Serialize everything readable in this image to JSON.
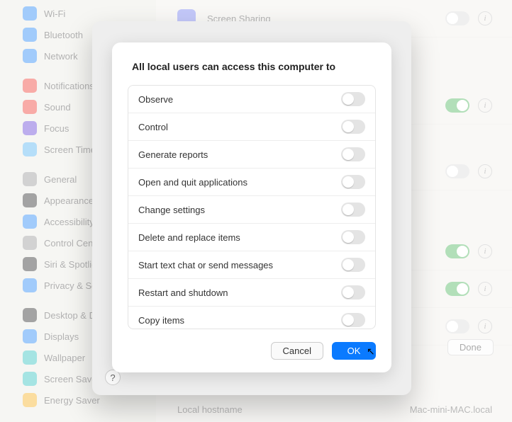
{
  "sidebar": {
    "groups": [
      [
        {
          "label": "Wi-Fi",
          "color": "#2f8cf6"
        },
        {
          "label": "Bluetooth",
          "color": "#2f8cf6"
        },
        {
          "label": "Network",
          "color": "#2f8cf6"
        }
      ],
      [
        {
          "label": "Notifications",
          "color": "#f0453c"
        },
        {
          "label": "Sound",
          "color": "#f0453c"
        },
        {
          "label": "Focus",
          "color": "#6b4bd8"
        },
        {
          "label": "Screen Time",
          "color": "#5bb5f2"
        }
      ],
      [
        {
          "label": "General",
          "color": "#9c9c9c"
        },
        {
          "label": "Appearance",
          "color": "#343434"
        },
        {
          "label": "Accessibility",
          "color": "#2f8cf6"
        },
        {
          "label": "Control Centre",
          "color": "#9c9c9c"
        },
        {
          "label": "Siri & Spotlight",
          "color": "#343434"
        },
        {
          "label": "Privacy & Security",
          "color": "#2f8cf6"
        }
      ],
      [
        {
          "label": "Desktop & Dock",
          "color": "#343434"
        },
        {
          "label": "Displays",
          "color": "#2f8cf6"
        },
        {
          "label": "Wallpaper",
          "color": "#39c3c0"
        },
        {
          "label": "Screen Saver",
          "color": "#39c3c0"
        },
        {
          "label": "Energy Saver",
          "color": "#f6b42c"
        }
      ]
    ]
  },
  "main": {
    "screensharing_label": "Screen Sharing",
    "done_label": "Done",
    "local_hostname_label": "Local hostname",
    "local_hostname_value": "Mac-mini-MAC.local"
  },
  "sheet": {
    "help_glyph": "?"
  },
  "dialog": {
    "title": "All local users can access this computer to",
    "permissions": [
      "Observe",
      "Control",
      "Generate reports",
      "Open and quit applications",
      "Change settings",
      "Delete and replace items",
      "Start text chat or send messages",
      "Restart and shutdown",
      "Copy items"
    ],
    "cancel_label": "Cancel",
    "ok_label": "OK"
  }
}
